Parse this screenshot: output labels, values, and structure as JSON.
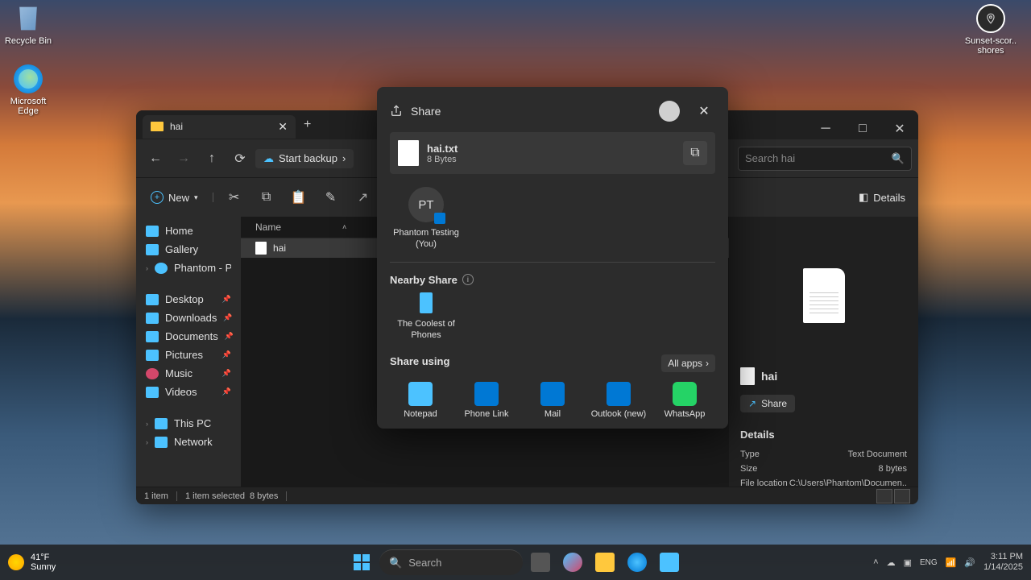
{
  "desktop": {
    "recycle_bin": "Recycle Bin",
    "edge": "Microsoft Edge",
    "sunset": "Sunset-scor.. shores"
  },
  "explorer": {
    "tab_title": "hai",
    "backup": "Start backup",
    "search_placeholder": "Search hai",
    "new_btn": "New",
    "details_btn": "Details",
    "sidebar": {
      "home": "Home",
      "gallery": "Gallery",
      "phantom": "Phantom - Personal",
      "desktop": "Desktop",
      "downloads": "Downloads",
      "documents": "Documents",
      "pictures": "Pictures",
      "music": "Music",
      "videos": "Videos",
      "thispc": "This PC",
      "network": "Network"
    },
    "list": {
      "col_name": "Name",
      "file": "hai"
    },
    "preview": {
      "name": "hai",
      "share": "Share",
      "details_hdr": "Details",
      "type_k": "Type",
      "type_v": "Text Document",
      "size_k": "Size",
      "size_v": "8 bytes",
      "loc_k": "File location",
      "loc_v": "C:\\Users\\Phantom\\Documen.."
    },
    "status": {
      "items": "1 item",
      "selected": "1 item selected",
      "size": "8 bytes"
    }
  },
  "share": {
    "title": "Share",
    "file_name": "hai.txt",
    "file_size": "8 Bytes",
    "person_initials": "PT",
    "person_name": "Phantom Testing (You)",
    "nearby_hdr": "Nearby Share",
    "nearby_device": "The Coolest of Phones",
    "share_using": "Share using",
    "all_apps": "All apps",
    "apps": {
      "notepad": "Notepad",
      "phonelink": "Phone Link",
      "mail": "Mail",
      "outlook": "Outlook (new)",
      "whatsapp": "WhatsApp"
    }
  },
  "taskbar": {
    "temp": "41°F",
    "weather": "Sunny",
    "search": "Search",
    "time": "3:11 PM",
    "date": "1/14/2025"
  }
}
